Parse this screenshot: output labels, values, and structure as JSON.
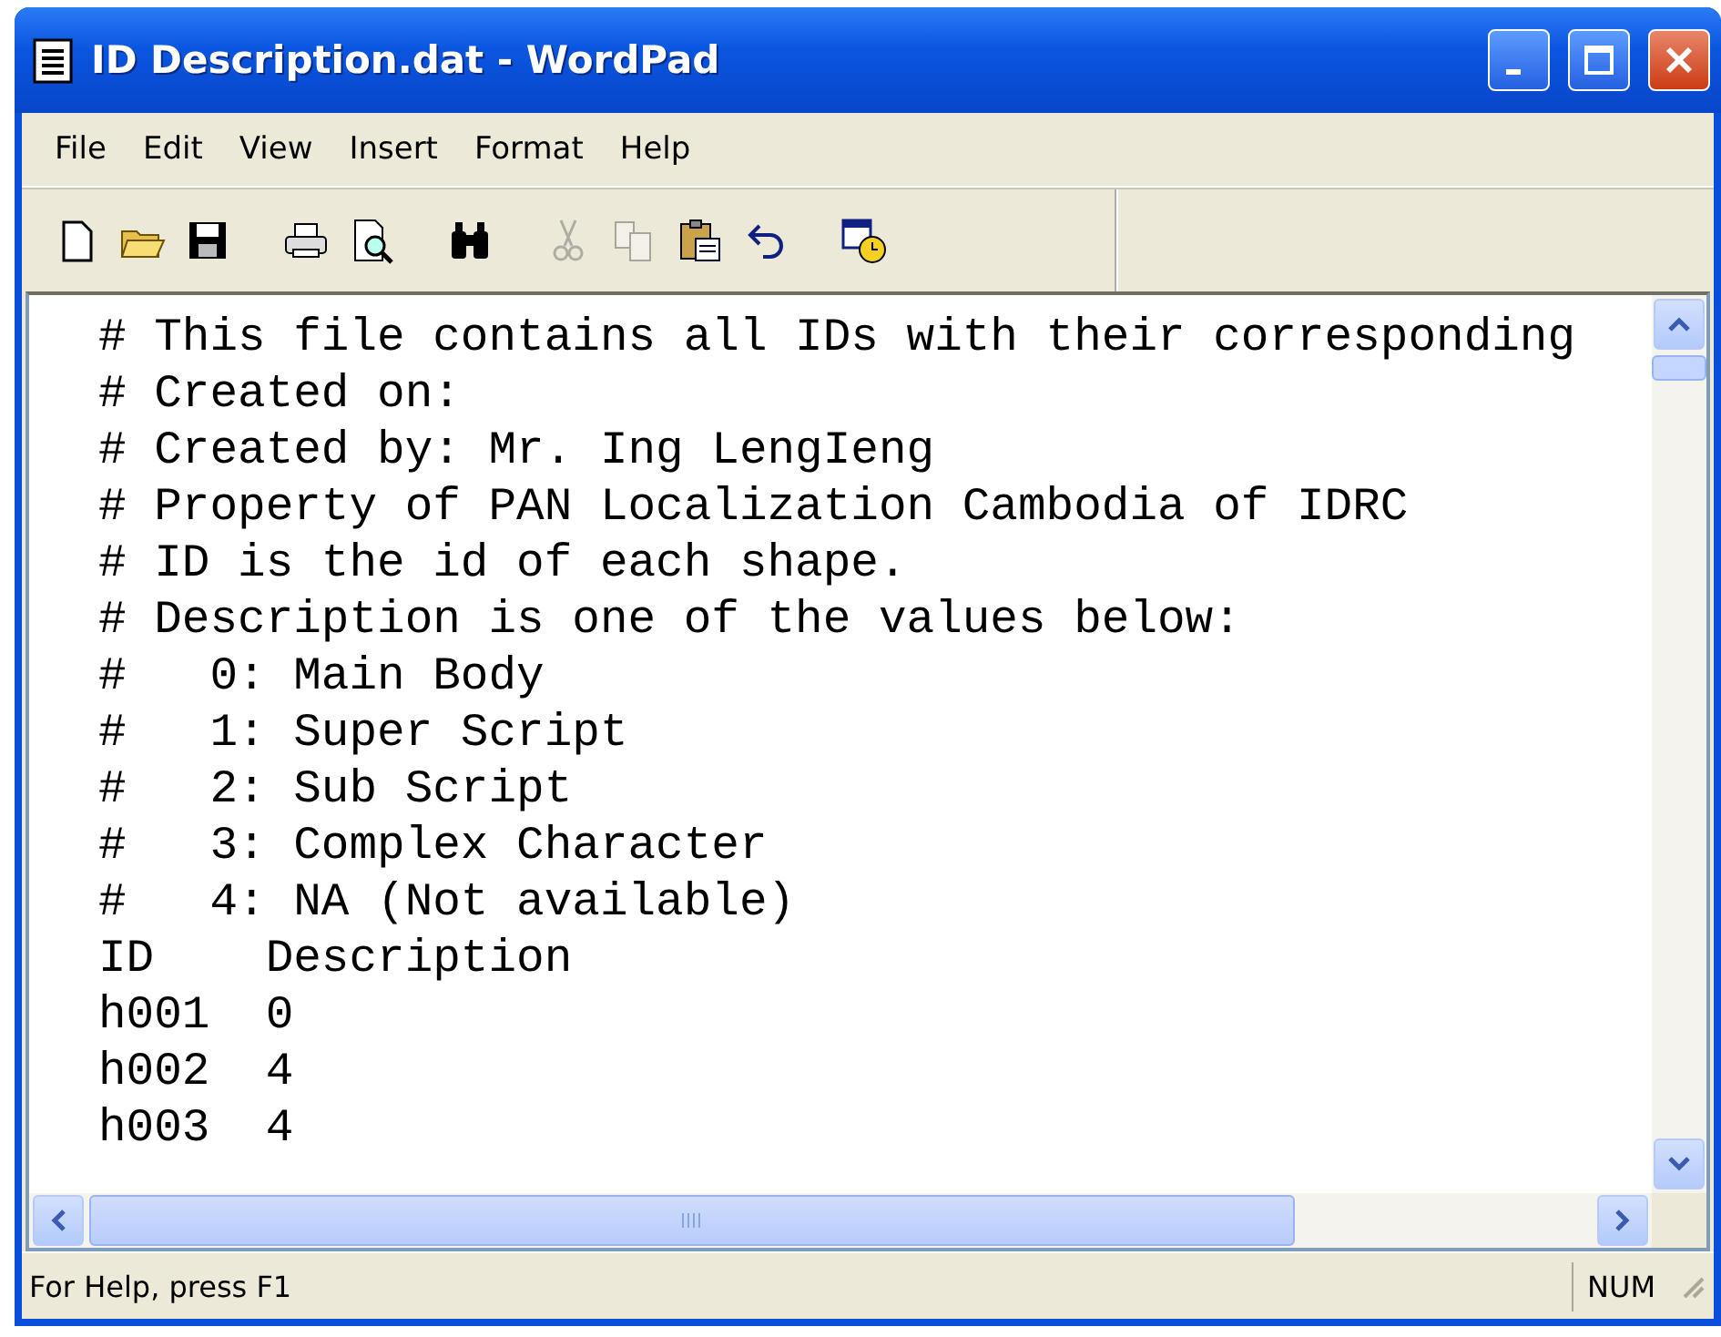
{
  "window": {
    "title": "ID Description.dat - WordPad"
  },
  "menu": [
    "File",
    "Edit",
    "View",
    "Insert",
    "Format",
    "Help"
  ],
  "toolbar": [
    {
      "kind": "new",
      "disabled": false
    },
    {
      "kind": "open",
      "disabled": false
    },
    {
      "kind": "save",
      "disabled": false
    },
    {
      "kind": "gap"
    },
    {
      "kind": "print",
      "disabled": false
    },
    {
      "kind": "preview",
      "disabled": false
    },
    {
      "kind": "gap"
    },
    {
      "kind": "find",
      "disabled": false
    },
    {
      "kind": "gap"
    },
    {
      "kind": "cut",
      "disabled": true
    },
    {
      "kind": "copy",
      "disabled": true
    },
    {
      "kind": "paste",
      "disabled": false
    },
    {
      "kind": "undo",
      "disabled": false
    },
    {
      "kind": "gap"
    },
    {
      "kind": "datetime",
      "disabled": false
    }
  ],
  "document": {
    "lines": [
      "# This file contains all IDs with their corresponding",
      "# Created on:",
      "# Created by: Mr. Ing LengIeng",
      "# Property of PAN Localization Cambodia of IDRC",
      "# ID is the id of each shape.",
      "# Description is one of the values below:",
      "#   0: Main Body",
      "#   1: Super Script",
      "#   2: Sub Script",
      "#   3: Complex Character",
      "#   4: NA (Not available)",
      "ID    Description",
      "h001  0",
      "h002  4",
      "h003  4"
    ]
  },
  "status_bar": {
    "text": "For Help, press F1",
    "panels": [
      "NUM"
    ]
  }
}
